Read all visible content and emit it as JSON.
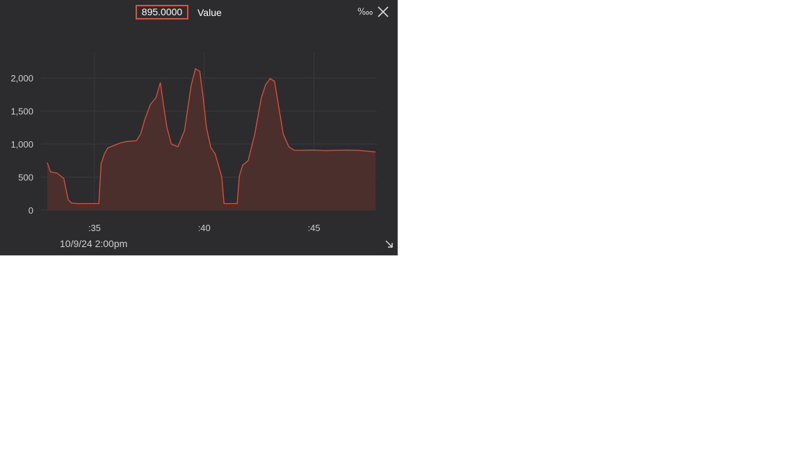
{
  "header": {
    "current_value": "895.0000",
    "series_label": "Value",
    "permyriad_label": "‱",
    "close_icon": "close-icon"
  },
  "footer": {
    "start_time_label": "10/9/24 2:00pm",
    "resize_icon": "resize-corner-icon"
  },
  "colors": {
    "background": "#2c2c2e",
    "line": "#e0523c",
    "fill": "#4a2f2d",
    "grid": "#3a3a3c"
  },
  "chart_data": {
    "type": "area",
    "title": "",
    "xlabel": "",
    "ylabel": "",
    "x_ticks": [
      ":35",
      ":40",
      ":45"
    ],
    "x_tick_minutes": [
      35,
      40,
      45
    ],
    "y_ticks": [
      "0",
      "500",
      "1,000",
      "1,500",
      "2,000"
    ],
    "y_tick_values": [
      0,
      500,
      1000,
      1500,
      2000
    ],
    "ylim": [
      0,
      2000
    ],
    "grid": true,
    "series": [
      {
        "name": "Value",
        "x": [
          32.85,
          33.0,
          33.3,
          33.6,
          33.8,
          33.95,
          34.2,
          34.6,
          35.0,
          35.2,
          35.3,
          35.45,
          35.6,
          35.9,
          36.2,
          36.5,
          36.9,
          37.1,
          37.3,
          37.55,
          37.8,
          38.0,
          38.15,
          38.3,
          38.5,
          38.8,
          39.1,
          39.4,
          39.6,
          39.8,
          39.95,
          40.1,
          40.3,
          40.5,
          40.8,
          40.9,
          41.0,
          41.15,
          41.5,
          41.6,
          41.75,
          42.0,
          42.3,
          42.6,
          42.8,
          43.0,
          43.2,
          43.4,
          43.6,
          43.85,
          44.1,
          44.5,
          45.0,
          45.5,
          46.0,
          46.5,
          47.0,
          47.5,
          47.8
        ],
        "y": [
          720,
          580,
          560,
          480,
          160,
          110,
          100,
          100,
          100,
          100,
          700,
          850,
          940,
          980,
          1020,
          1040,
          1050,
          1150,
          1380,
          1600,
          1700,
          1930,
          1580,
          1250,
          1000,
          960,
          1200,
          1880,
          2140,
          2100,
          1700,
          1250,
          950,
          850,
          500,
          100,
          100,
          100,
          100,
          520,
          680,
          750,
          1150,
          1700,
          1900,
          1990,
          1950,
          1550,
          1150,
          960,
          905,
          905,
          910,
          900,
          905,
          910,
          905,
          890,
          880
        ]
      }
    ]
  }
}
